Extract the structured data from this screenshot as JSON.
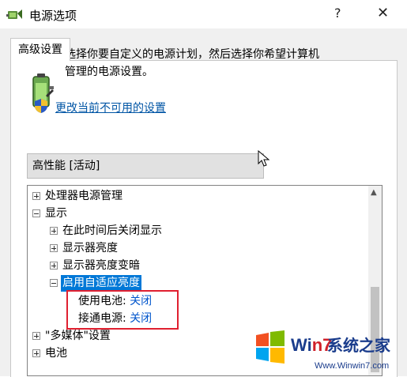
{
  "window": {
    "title": "电源选项",
    "help_label": "?",
    "close_label": "✕"
  },
  "tabs": [
    {
      "label": "高级设置"
    }
  ],
  "description": "选择你要自定义的电源计划，然后选择你希望计算机管理的电源设置。",
  "change_link": "更改当前不可用的设置",
  "plan_select": {
    "value": "高性能 [活动]"
  },
  "tree": {
    "items": [
      {
        "label": "处理器电源管理",
        "expander": "plus"
      },
      {
        "label": "显示",
        "expander": "minus"
      },
      {
        "label": "在此时间后关闭显示",
        "expander": "plus"
      },
      {
        "label": "显示器亮度",
        "expander": "plus"
      },
      {
        "label": "显示器亮度变暗",
        "expander": "plus"
      },
      {
        "label": "启用自适应亮度",
        "expander": "minus"
      },
      {
        "label": "使用电池:",
        "value": "关闭"
      },
      {
        "label": "接通电源:",
        "value": "关闭"
      },
      {
        "label": "\"多媒体\"设置",
        "expander": "plus"
      },
      {
        "label": "电池",
        "expander": "plus"
      }
    ]
  },
  "watermark": {
    "brand_prefix": "Wi",
    "brand_mid": "n7",
    "brand_suffix": "系统之家",
    "url": "Www.Winwin7.com"
  },
  "colors": {
    "selection": "#0078d7",
    "link": "#0055a5",
    "highlight_box": "#e02030"
  }
}
